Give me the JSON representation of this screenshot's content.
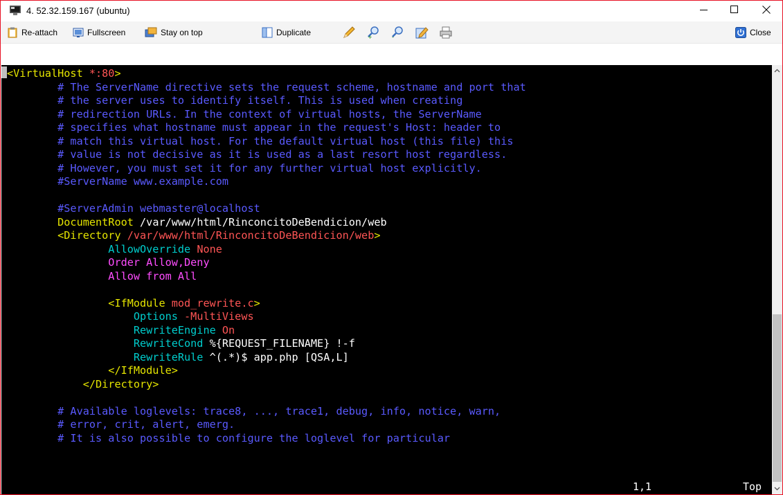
{
  "window": {
    "title": "4. 52.32.159.167 (ubuntu)",
    "minimize_icon": "minimize-icon",
    "maximize_icon": "maximize-icon",
    "close_icon": "close-icon"
  },
  "toolbar": {
    "reattach_label": "Re-attach",
    "fullscreen_label": "Fullscreen",
    "stay_on_top_label": "Stay on top",
    "duplicate_label": "Duplicate",
    "close_label": "Close",
    "icons": [
      "pencil-icon",
      "zoom-in-icon",
      "zoom-out-icon",
      "edit-icon",
      "print-icon"
    ]
  },
  "colors": {
    "comment": "#5a5aff",
    "directive": "#00cdcd",
    "tag": "#e5e500",
    "path": "#ff5555",
    "keyword": "#ff4dff",
    "default": "#ffffff",
    "background": "#000000"
  },
  "terminal": {
    "lines": [
      [
        [
          "tag",
          "<VirtualHost "
        ],
        [
          "path",
          "*:80"
        ],
        [
          "tag",
          ">"
        ]
      ],
      [
        [
          "comment",
          "        # The ServerName directive sets the request scheme, hostname and port that"
        ]
      ],
      [
        [
          "comment",
          "        # the server uses to identify itself. This is used when creating"
        ]
      ],
      [
        [
          "comment",
          "        # redirection URLs. In the context of virtual hosts, the ServerName"
        ]
      ],
      [
        [
          "comment",
          "        # specifies what hostname must appear in the request's Host: header to"
        ]
      ],
      [
        [
          "comment",
          "        # match this virtual host. For the default virtual host (this file) this"
        ]
      ],
      [
        [
          "comment",
          "        # value is not decisive as it is used as a last resort host regardless."
        ]
      ],
      [
        [
          "comment",
          "        # However, you must set it for any further virtual host explicitly."
        ]
      ],
      [
        [
          "comment",
          "        #ServerName www.example.com"
        ]
      ],
      [],
      [
        [
          "comment",
          "        #ServerAdmin webmaster@localhost"
        ]
      ],
      [
        [
          "tag",
          "        DocumentRoot "
        ],
        [
          "default",
          "/var/www/html/RinconcitoDeBendicion/web"
        ]
      ],
      [
        [
          "tag",
          "        <Directory "
        ],
        [
          "path",
          "/var/www/html/RinconcitoDeBendicion/web"
        ],
        [
          "tag",
          ">"
        ]
      ],
      [
        [
          "directive",
          "                AllowOverride "
        ],
        [
          "path",
          "None"
        ]
      ],
      [
        [
          "keyword",
          "                Order Allow,Deny"
        ]
      ],
      [
        [
          "keyword",
          "                Allow from All"
        ]
      ],
      [],
      [
        [
          "tag",
          "                <IfModule "
        ],
        [
          "path",
          "mod_rewrite.c"
        ],
        [
          "tag",
          ">"
        ]
      ],
      [
        [
          "directive",
          "                    Options "
        ],
        [
          "path",
          "-MultiViews"
        ]
      ],
      [
        [
          "directive",
          "                    RewriteEngine "
        ],
        [
          "path",
          "On"
        ]
      ],
      [
        [
          "directive",
          "                    RewriteCond "
        ],
        [
          "default",
          "%{REQUEST_FILENAME} !-f"
        ]
      ],
      [
        [
          "directive",
          "                    RewriteRule "
        ],
        [
          "default",
          "^(.*)$ app.php [QSA,L]"
        ]
      ],
      [
        [
          "tag",
          "                </IfModule>"
        ]
      ],
      [
        [
          "tag",
          "            </Directory>"
        ]
      ],
      [],
      [
        [
          "comment",
          "        # Available loglevels: trace8, ..., trace1, debug, info, notice, warn,"
        ]
      ],
      [
        [
          "comment",
          "        # error, crit, alert, emerg."
        ]
      ],
      [
        [
          "comment",
          "        # It is also possible to configure the loglevel for particular"
        ]
      ]
    ],
    "status_position": "1,1",
    "status_scroll": "Top"
  }
}
